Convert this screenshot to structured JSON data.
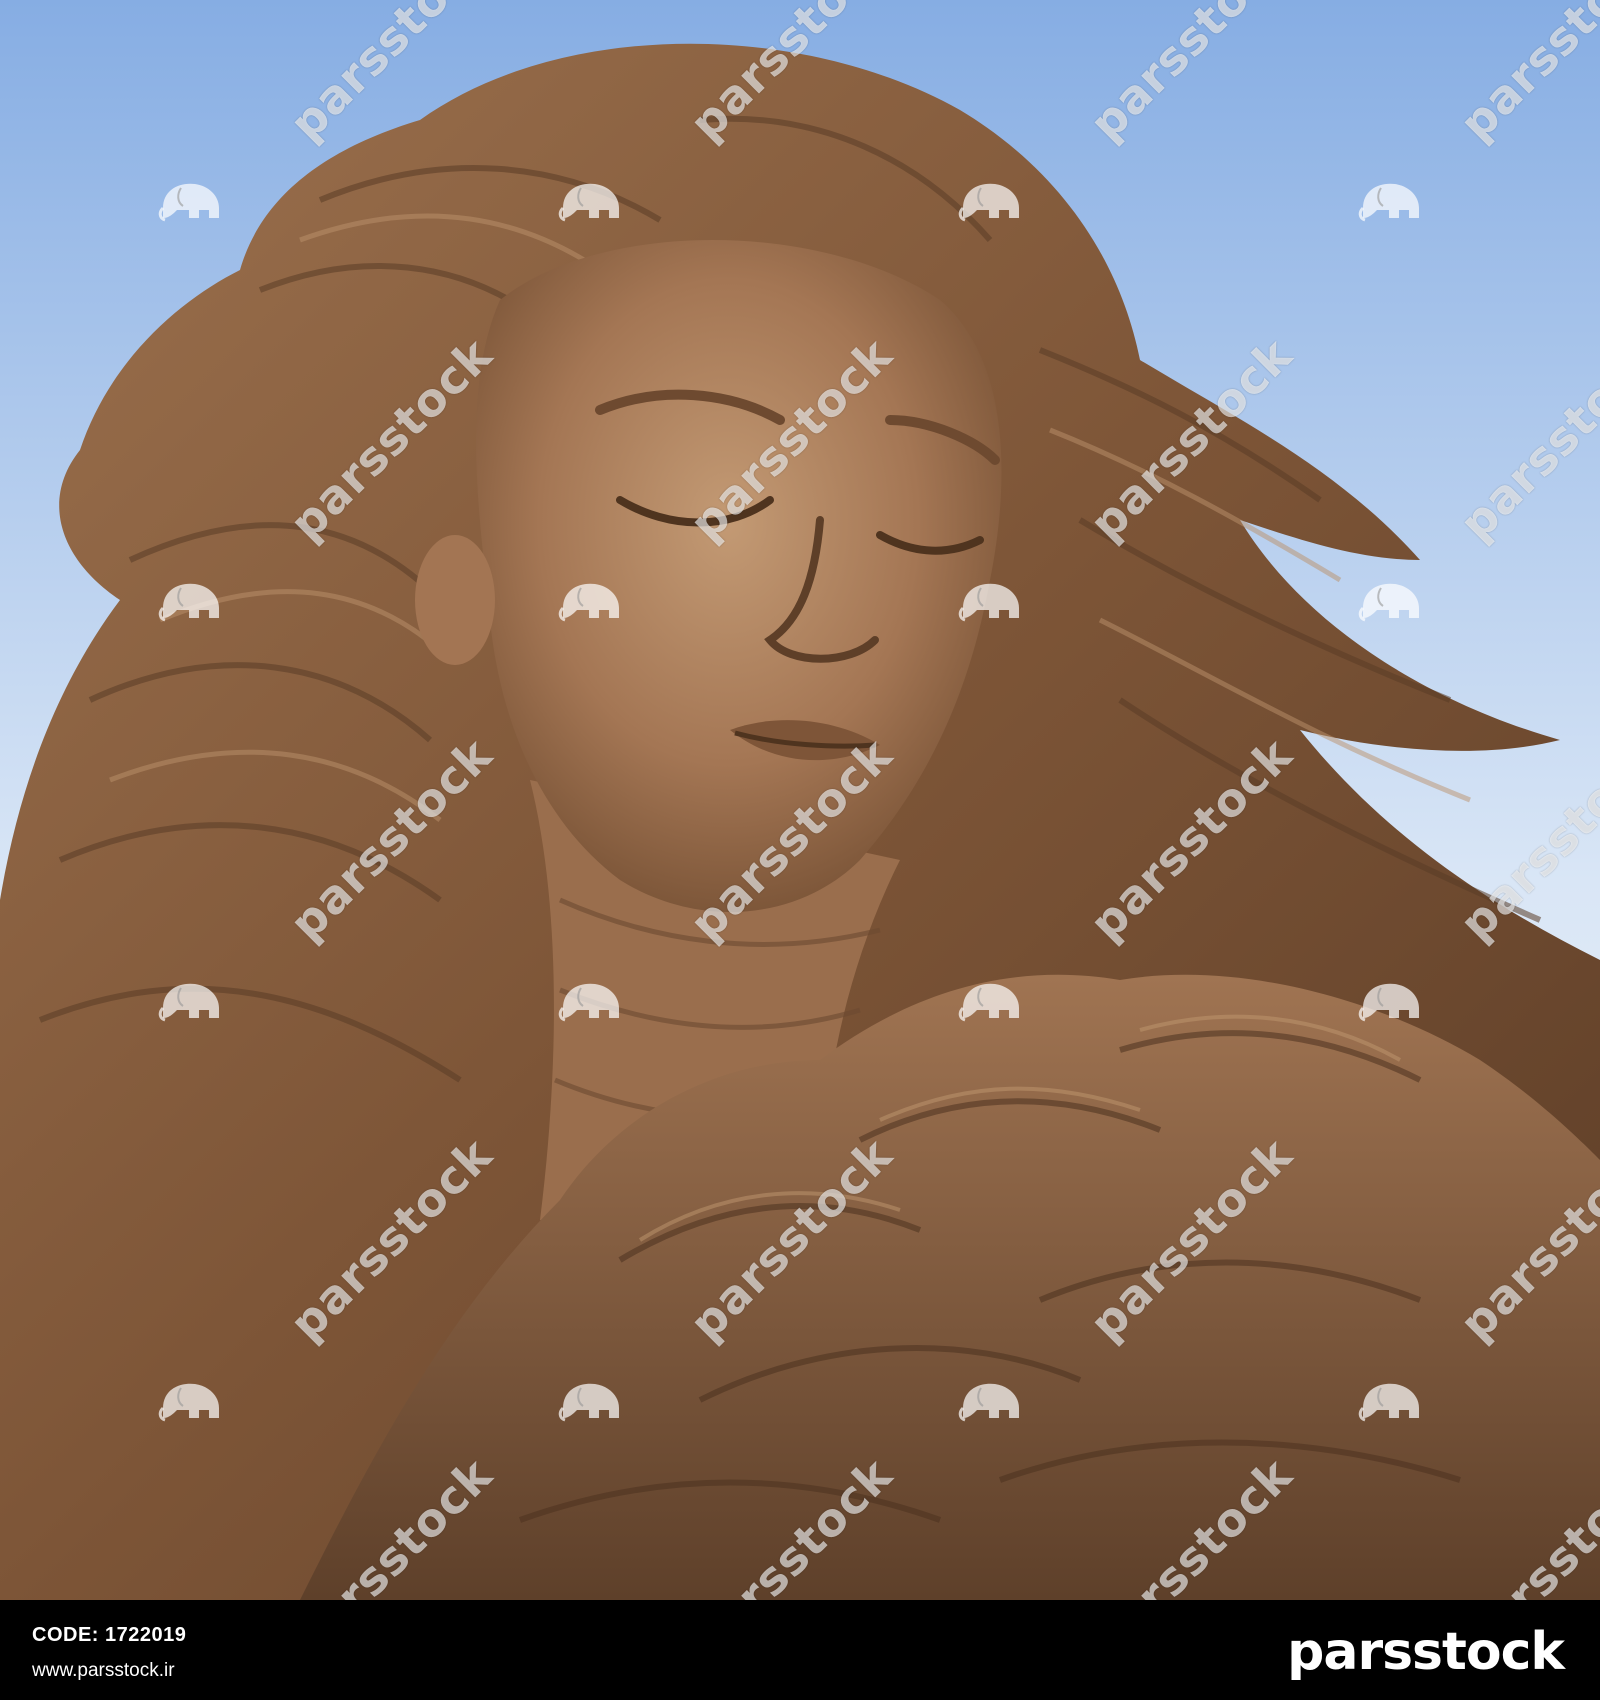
{
  "photo": {
    "subject": "sand-sculpture-woman",
    "sky_top": "#8fb4e6",
    "sky_bottom": "#f2f6fb",
    "sand_light": "#b58a62",
    "sand_mid": "#8f6544",
    "sand_dark": "#5a3d28"
  },
  "watermark": {
    "text": "parsstock",
    "icon": "elephant-icon"
  },
  "footer": {
    "code_label": "CODE:",
    "code_value": "1722019",
    "website": "www.parsstock.ir",
    "logo_text": "parsstock"
  }
}
